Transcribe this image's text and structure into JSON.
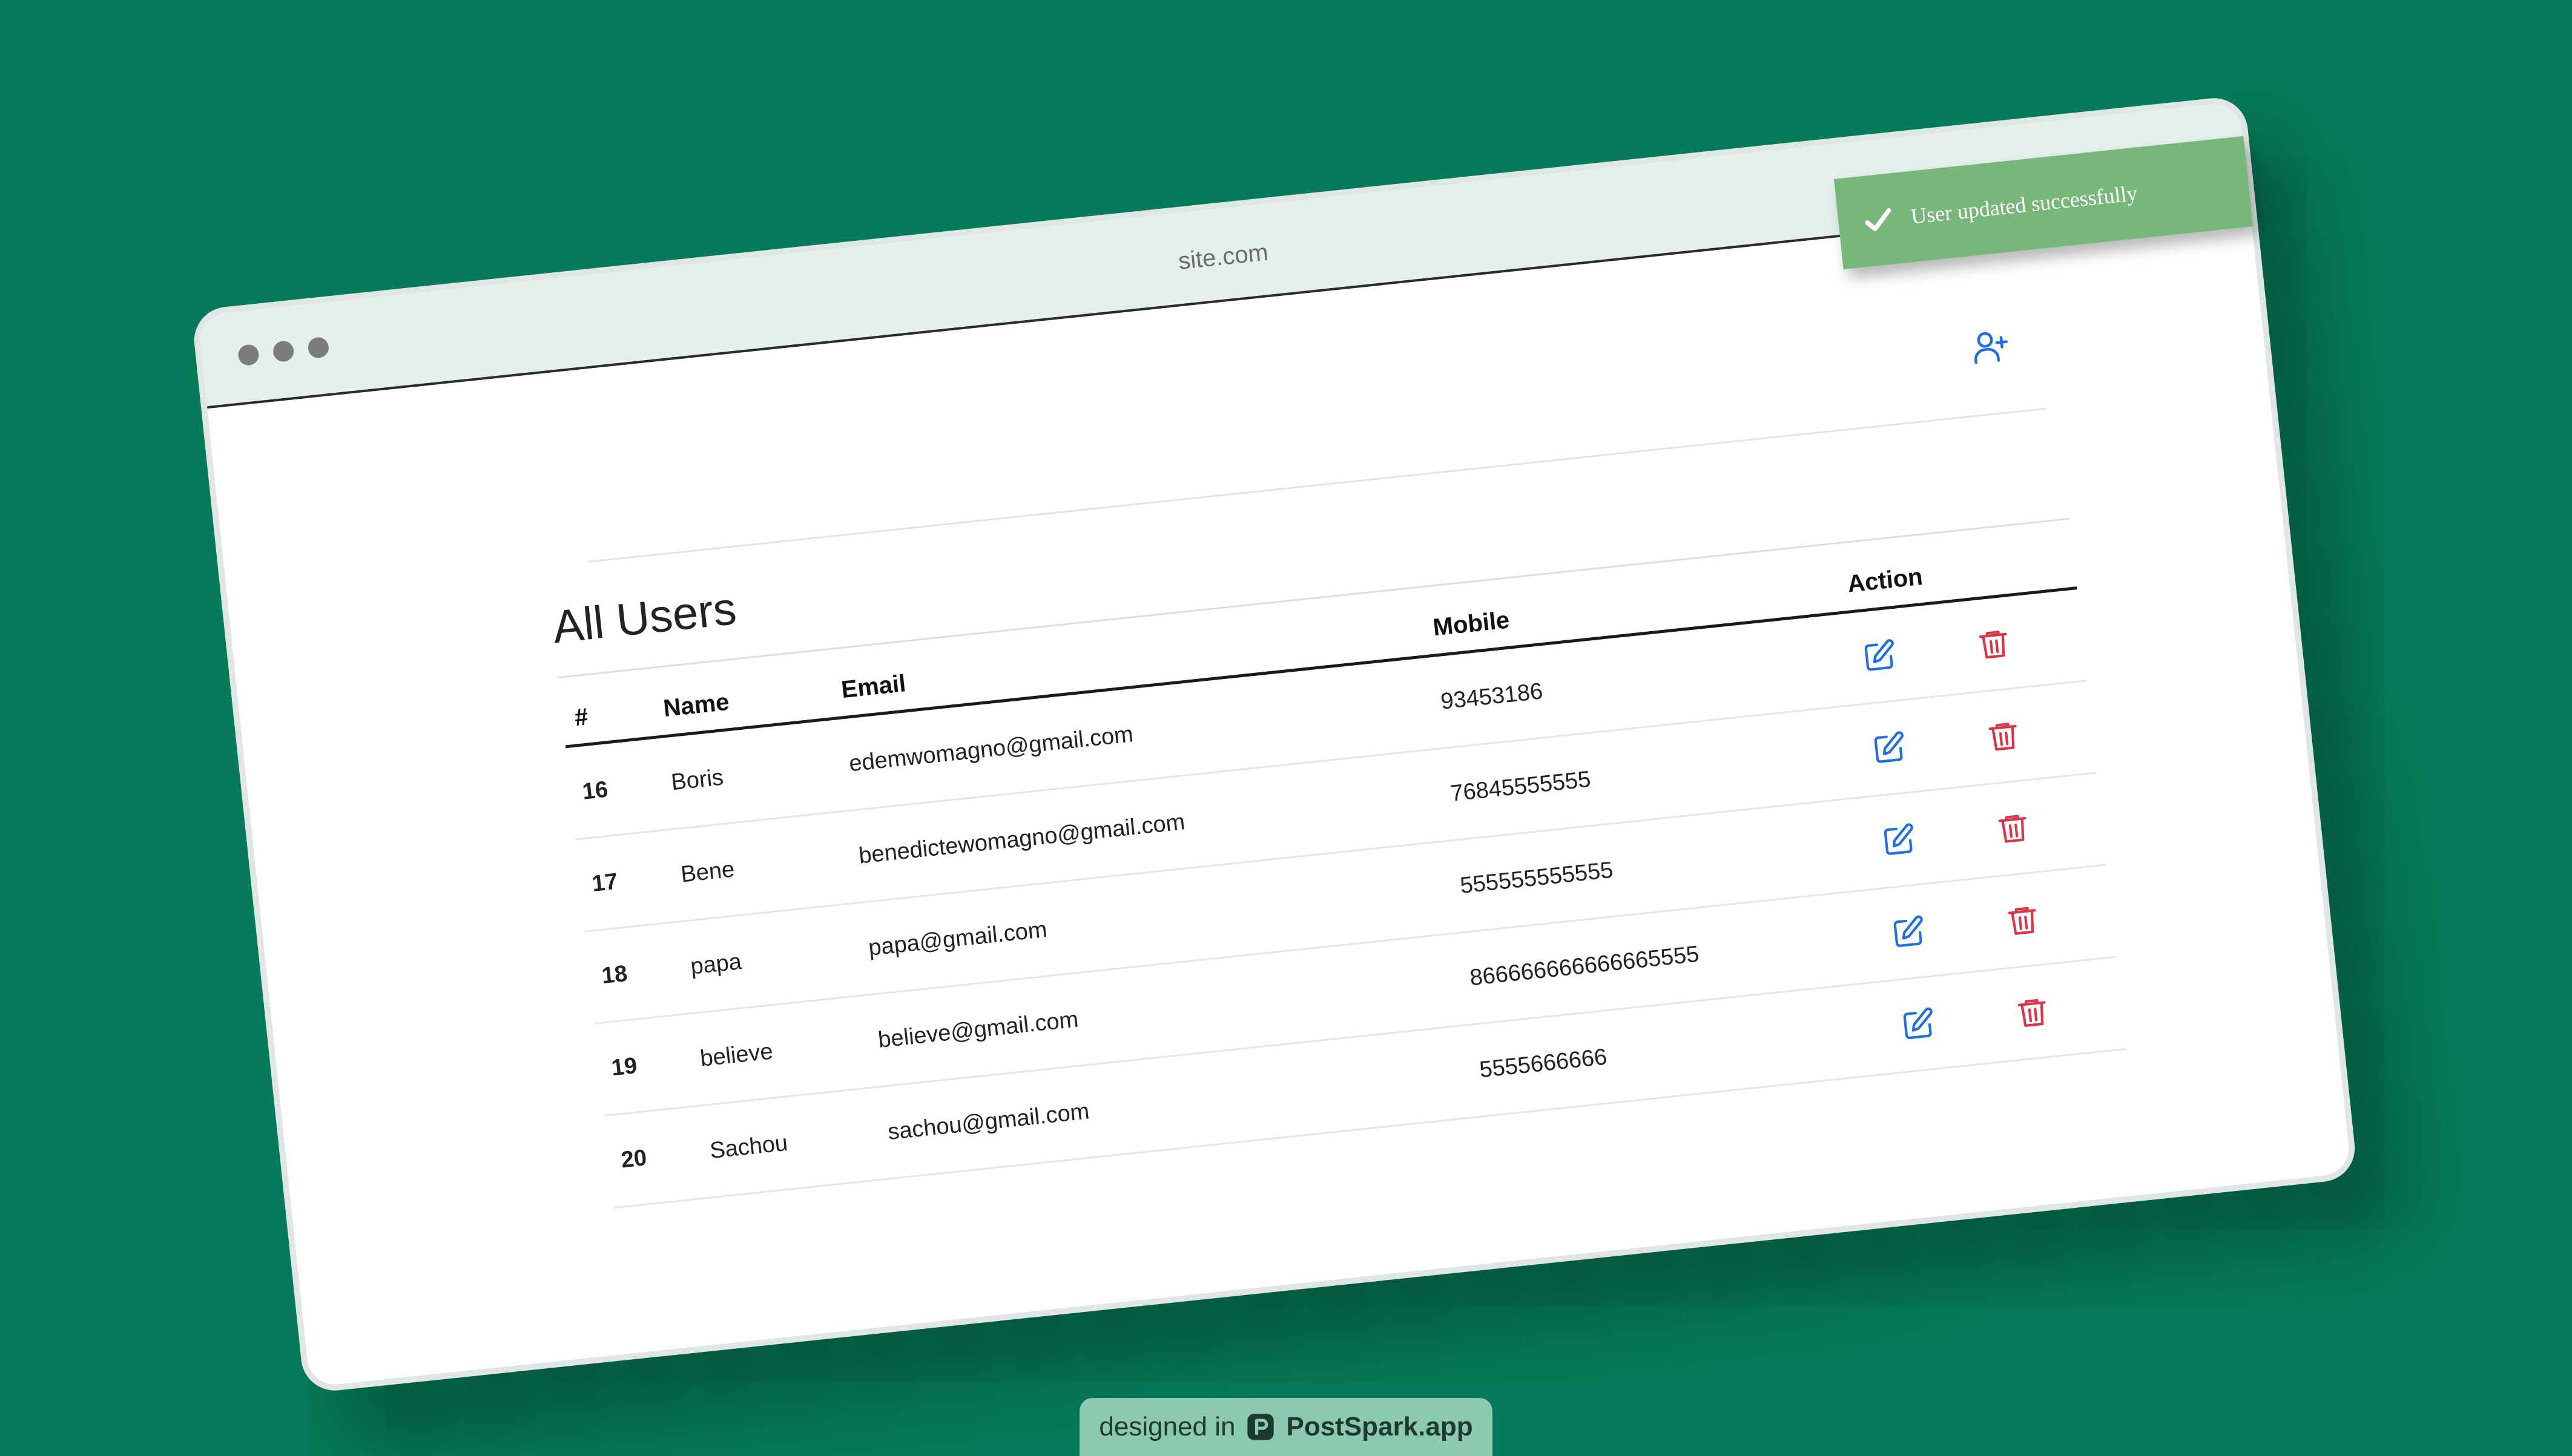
{
  "browser": {
    "url": "site.com"
  },
  "toast": {
    "message": "User updated successfully"
  },
  "page": {
    "title": "All Users"
  },
  "table": {
    "headers": {
      "id": "#",
      "name": "Name",
      "email": "Email",
      "mobile": "Mobile",
      "action": "Action"
    },
    "rows": [
      {
        "id": "16",
        "name": "Boris",
        "email": "edemwomagno@gmail.com",
        "mobile": "93453186"
      },
      {
        "id": "17",
        "name": "Bene",
        "email": "benedictewomagno@gmail.com",
        "mobile": "76845555555"
      },
      {
        "id": "18",
        "name": "papa",
        "email": "papa@gmail.com",
        "mobile": "555555555555"
      },
      {
        "id": "19",
        "name": "believe",
        "email": "believe@gmail.com",
        "mobile": "866666666666665555"
      },
      {
        "id": "20",
        "name": "Sachou",
        "email": "sachou@gmail.com",
        "mobile": "5555666666"
      }
    ]
  },
  "icons": {
    "add_user": "user-plus-icon",
    "edit": "pencil-square-icon",
    "delete": "trash-icon",
    "toast": "check-icon",
    "badge": "postspark-logo-icon"
  },
  "colors": {
    "background": "#067a5a",
    "titlebar": "#e5f0ec",
    "edit_icon": "#1f6fe0",
    "delete_icon": "#dc3545",
    "toast": "#77b77a"
  },
  "badge": {
    "prefix": "designed in",
    "brand": "PostSpark.app"
  }
}
